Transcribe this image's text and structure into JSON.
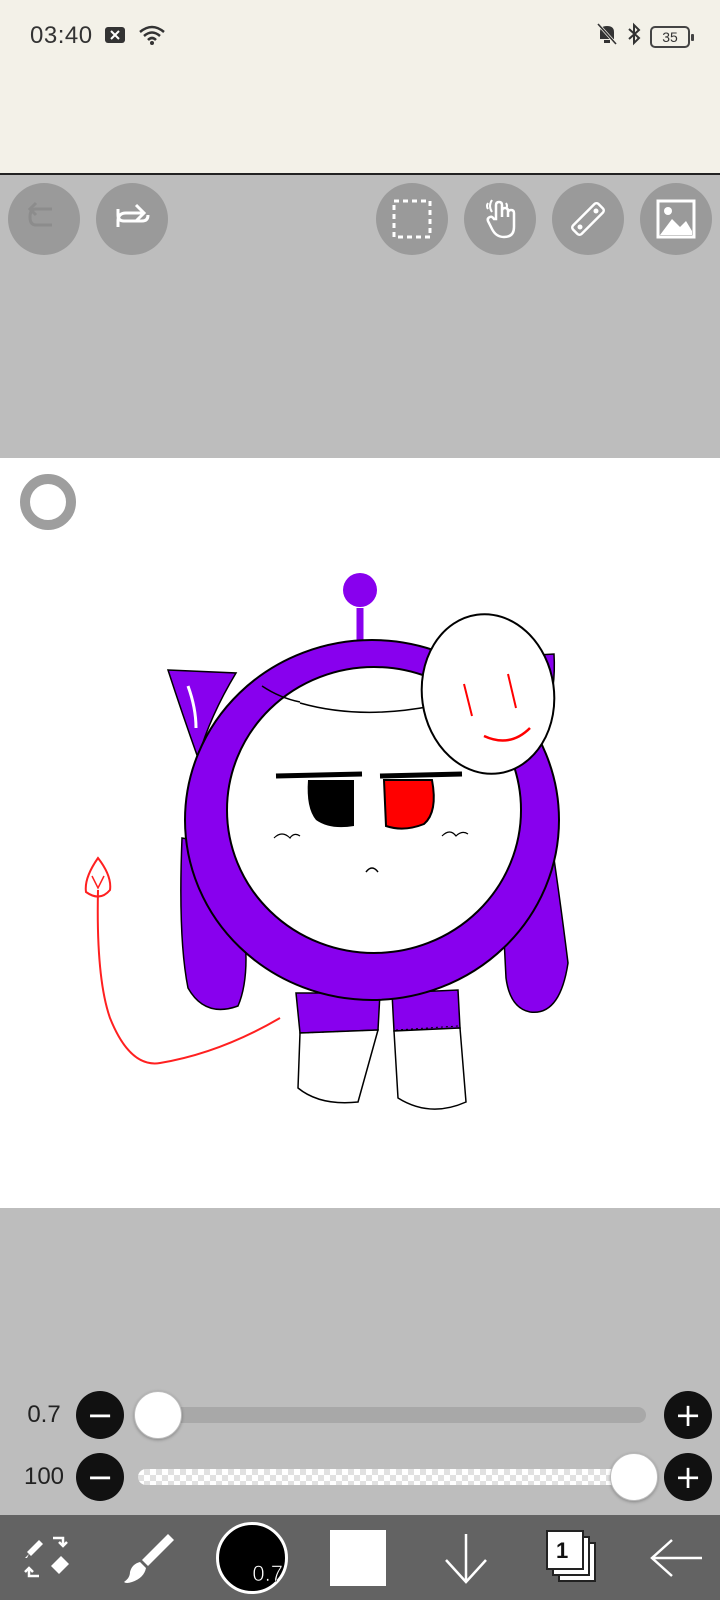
{
  "status_bar": {
    "time": "03:40",
    "battery_level": "35",
    "icons": [
      "notification-x-icon",
      "wifi-icon",
      "mute-bell-icon",
      "bluetooth-icon",
      "battery-icon"
    ]
  },
  "top_toolbar": {
    "buttons": [
      "undo-icon",
      "redo-icon",
      "selection-icon",
      "gesture-icon",
      "ruler-icon",
      "image-icon"
    ]
  },
  "sliders": {
    "brush_size": {
      "value_label": "0.7",
      "fraction": 0.0
    },
    "opacity": {
      "value_label": "100",
      "fraction": 1.0
    }
  },
  "bottom_toolbar": {
    "brush_size_label": "0.7",
    "current_color": "#ffffff",
    "layer_count": "1",
    "icons": [
      "tool-switch-icon",
      "brush-icon",
      "brush-size-indicator",
      "color-swatch",
      "download-icon",
      "layers-icon",
      "back-arrow-icon"
    ]
  },
  "colors": {
    "purple": "#8800ee",
    "red": "#ff0000",
    "toolbar_bg": "#636363",
    "workspace_bg": "#bdbdbd",
    "status_bg": "#f3f1e8"
  }
}
